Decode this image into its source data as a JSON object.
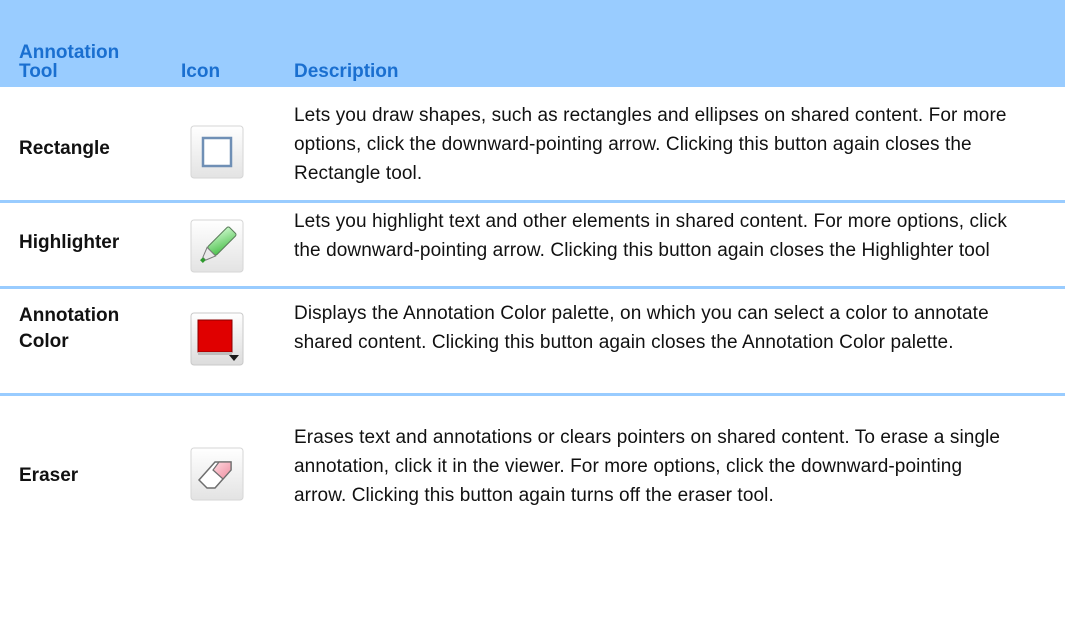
{
  "header": {
    "tool": "Annotation\nTool",
    "icon": "Icon",
    "description": "Description"
  },
  "colors": {
    "header_bg": "#99ccff",
    "header_text": "#1a6fd0",
    "divider": "#99ccff",
    "annotation_red": "#e00000"
  },
  "rows": [
    {
      "name": "Rectangle",
      "icon": "rectangle-icon",
      "description": "Lets you draw shapes, such as rectangles and ellipses on shared content. For more options, click the downward-pointing arrow. Clicking this button again closes the Rectangle tool."
    },
    {
      "name": "Highlighter",
      "icon": "highlighter-icon",
      "description": "Lets you highlight text and other elements in shared content. For more options, click the downward-pointing arrow. Clicking this button again closes the Highlighter tool"
    },
    {
      "name": "Annotation\nColor",
      "icon": "annotation-color-icon",
      "description": "Displays the Annotation Color palette, on which you can select a color to annotate shared content. Clicking this button again closes the Annotation Color palette."
    },
    {
      "name": "Eraser",
      "icon": "eraser-icon",
      "description": "Erases text and annotations or clears pointers on shared content. To erase a single annotation, click it in the viewer. For more options, click the downward-pointing arrow. Clicking this button again turns off the eraser tool."
    }
  ]
}
